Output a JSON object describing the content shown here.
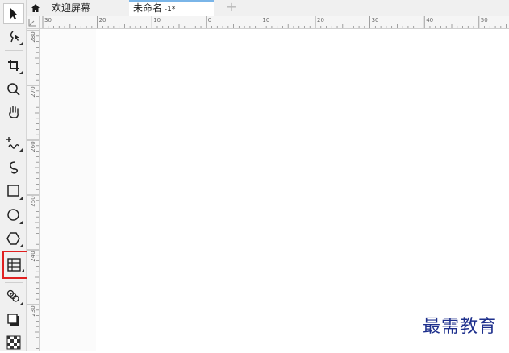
{
  "tabs": {
    "home_label": "欢迎屏幕",
    "doc_label": "未命名",
    "doc_suffix": " -1*",
    "add_label": "+"
  },
  "ruler": {
    "horizontal": [
      "30",
      "20",
      "10",
      "0",
      "10",
      "20",
      "30",
      "40",
      "50"
    ],
    "vertical": [
      "280",
      "270",
      "260",
      "250",
      "240",
      "230"
    ]
  },
  "toolbox": {
    "tools": [
      {
        "name": "pick-tool",
        "icon": "arrow-pointer-icon"
      },
      {
        "name": "shape-tool",
        "icon": "shape-node-icon"
      },
      {
        "name": "crop-tool",
        "icon": "crop-icon"
      },
      {
        "name": "zoom-tool",
        "icon": "magnifier-icon"
      },
      {
        "name": "pan-tool",
        "icon": "hand-icon"
      },
      {
        "name": "freehand-tool",
        "icon": "freehand-icon"
      },
      {
        "name": "artistic-media-tool",
        "icon": "curve-pen-icon"
      },
      {
        "name": "rectangle-tool",
        "icon": "rectangle-icon"
      },
      {
        "name": "ellipse-tool",
        "icon": "ellipse-icon"
      },
      {
        "name": "polygon-tool",
        "icon": "polygon-icon"
      },
      {
        "name": "table-tool",
        "icon": "table-icon",
        "highlighted": true
      },
      {
        "name": "blend-tool",
        "icon": "blend-icon"
      },
      {
        "name": "drop-shadow-tool",
        "icon": "shadow-icon"
      },
      {
        "name": "transparency-tool",
        "icon": "checker-icon"
      }
    ]
  },
  "colors": {
    "highlight": "#e02020",
    "active_tab_accent": "#7ab5e8",
    "watermark": "#1d2f8c"
  },
  "watermark": "最需教育"
}
